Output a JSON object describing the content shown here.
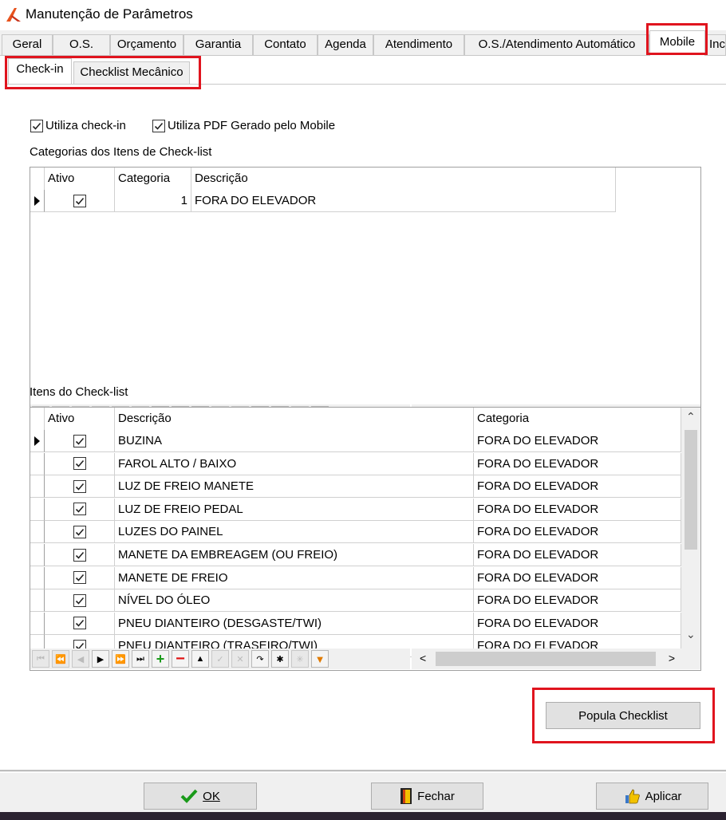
{
  "window": {
    "title": "Manutenção de Parâmetros",
    "icon": "app-logo-icon"
  },
  "tabs": [
    "Geral",
    "O.S.",
    "Orçamento",
    "Garantia",
    "Contato",
    "Agenda",
    "Atendimento",
    "O.S./Atendimento Automático",
    "Mobile",
    "Inc"
  ],
  "active_tab": "Mobile",
  "subtabs": [
    "Check-in",
    "Checklist Mecânico"
  ],
  "active_subtab": "Check-in",
  "options": {
    "use_checkin": {
      "label": "Utiliza check-in",
      "checked": true
    },
    "use_pdf": {
      "label": "Utiliza PDF Gerado pelo Mobile",
      "checked": true
    }
  },
  "categories": {
    "label": "Categorias dos Itens de Check-list",
    "headers": {
      "ativo": "Ativo",
      "categoria": "Categoria",
      "descricao": "Descrição"
    },
    "rows": [
      {
        "ativo": true,
        "categoria": "1",
        "descricao": "FORA DO ELEVADOR"
      }
    ]
  },
  "items": {
    "label": "Itens do Check-list",
    "headers": {
      "ativo": "Ativo",
      "descricao": "Descrição",
      "categoria": "Categoria"
    },
    "rows": [
      {
        "ativo": true,
        "descricao": "BUZINA",
        "categoria": "FORA DO ELEVADOR"
      },
      {
        "ativo": true,
        "descricao": "FAROL ALTO / BAIXO",
        "categoria": "FORA DO ELEVADOR"
      },
      {
        "ativo": true,
        "descricao": "LUZ DE FREIO MANETE",
        "categoria": "FORA DO ELEVADOR"
      },
      {
        "ativo": true,
        "descricao": "LUZ DE FREIO PEDAL",
        "categoria": "FORA DO ELEVADOR"
      },
      {
        "ativo": true,
        "descricao": "LUZES DO PAINEL",
        "categoria": "FORA DO ELEVADOR"
      },
      {
        "ativo": true,
        "descricao": "MANETE DA EMBREAGEM (OU FREIO)",
        "categoria": "FORA DO ELEVADOR"
      },
      {
        "ativo": true,
        "descricao": "MANETE DE FREIO",
        "categoria": "FORA DO ELEVADOR"
      },
      {
        "ativo": true,
        "descricao": "NÍVEL DO ÓLEO",
        "categoria": "FORA DO ELEVADOR"
      },
      {
        "ativo": true,
        "descricao": "PNEU DIANTEIRO (DESGASTE/TWI)",
        "categoria": "FORA DO ELEVADOR"
      },
      {
        "ativo": true,
        "descricao": "PNEU DIANTEIRO (TRASEIRO/TWI)",
        "categoria": "FORA DO ELEVADOR"
      }
    ]
  },
  "buttons": {
    "popula": "Popula Checklist",
    "ok": "OK",
    "fechar": "Fechar",
    "aplicar": "Aplicar"
  },
  "colors": {
    "highlight": "#e0141e",
    "plus": "#1a9a1a",
    "minus": "#e01010"
  }
}
